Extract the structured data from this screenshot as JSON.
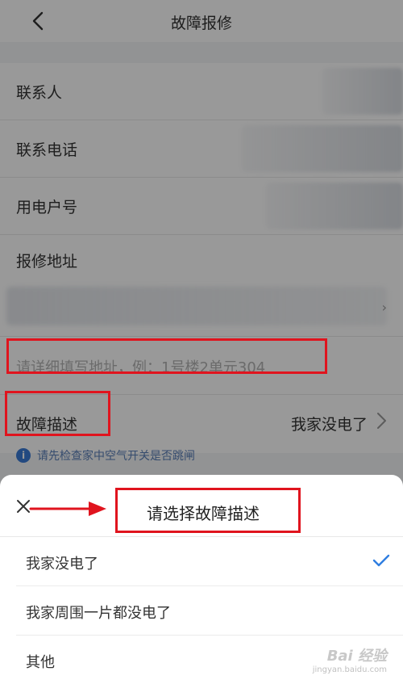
{
  "header": {
    "title": "故障报修"
  },
  "form": {
    "contact_label": "联系人",
    "phone_label": "联系电话",
    "account_label": "用电户号",
    "address_label": "报修地址",
    "detail_placeholder": "请详细填写地址，例：1号楼2单元304",
    "fault_label": "故障描述",
    "fault_value": "我家没电了",
    "tip": "请先检查家中空气开关是否跳闸"
  },
  "sheet": {
    "title": "请选择故障描述",
    "options": [
      {
        "label": "我家没电了",
        "selected": true
      },
      {
        "label": "我家周围一片都没电了",
        "selected": false
      },
      {
        "label": "其他",
        "selected": false
      }
    ]
  },
  "watermark": {
    "brand": "Bai 经验",
    "url": "jingyan.baidu.com"
  },
  "colors": {
    "annotation_red": "#e0141e",
    "accent_blue": "#2f7ee0",
    "overlay": "rgba(0,0,0,0.40)"
  },
  "icons": [
    "back-arrow-icon",
    "chevron-right-icon",
    "info-icon",
    "close-icon",
    "check-icon",
    "red-pointer-arrow"
  ]
}
